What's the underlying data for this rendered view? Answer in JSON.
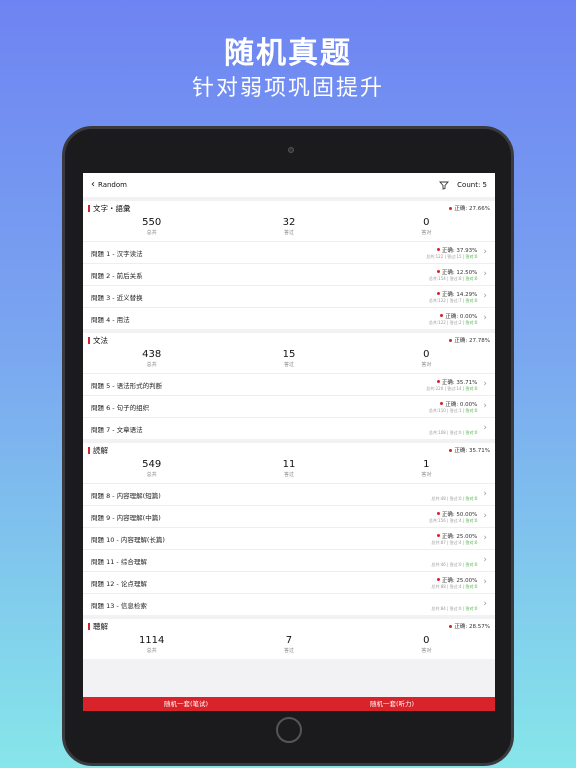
{
  "promo": {
    "title": "随机真题",
    "subtitle": "针对弱项巩固提升"
  },
  "nav": {
    "back_label": "Random",
    "count_label": "Count: 5"
  },
  "labels": {
    "total": "总共",
    "answered": "答过",
    "correct": "答对"
  },
  "sections": [
    {
      "title": "文字・語彙",
      "rate": "正确: 27.66%",
      "stats": {
        "total": "550",
        "answered": "32",
        "correct": "0"
      },
      "rows": [
        {
          "title": "問題 1 -   汉字读法",
          "rate": "正确: 37.93%",
          "meta": "总共:122 | 答过:15 | ",
          "meta_green": "答对:0"
        },
        {
          "title": "問題 2 -   前后关系",
          "rate": "正确: 12.50%",
          "meta": "总共:154 | 答过:8 | ",
          "meta_green": "答对:0"
        },
        {
          "title": "問題 3 -   近义替换",
          "rate": "正确: 14.29%",
          "meta": "总共:122 | 答过:7 | ",
          "meta_green": "答对:0"
        },
        {
          "title": "問題 4 -   用法",
          "rate": "正确: 0.00%",
          "meta": "总共:122 | 答过:2 | ",
          "meta_green": "答对:0"
        }
      ]
    },
    {
      "title": "文法",
      "rate": "正确: 27.78%",
      "stats": {
        "total": "438",
        "answered": "15",
        "correct": "0"
      },
      "rows": [
        {
          "title": "問題 5 -   语法形式的判断",
          "rate": "正确: 35.71%",
          "meta": "总共:220 | 答过:14 | ",
          "meta_green": "答对:0"
        },
        {
          "title": "問題 6 -   句子的组织",
          "rate": "正确: 0.00%",
          "meta": "总共:110 | 答过:1 | ",
          "meta_green": "答对:0"
        },
        {
          "title": "問題 7 -   文章语法",
          "rate": "",
          "meta": "总共:108 | 答过:0 | ",
          "meta_green": "答对:0"
        }
      ]
    },
    {
      "title": "読解",
      "rate": "正确: 35.71%",
      "stats": {
        "total": "549",
        "answered": "11",
        "correct": "1"
      },
      "rows": [
        {
          "title": "問題 8 -   内容理解(短篇)",
          "rate": "",
          "meta": "总共:48 | 答过:0 | ",
          "meta_green": "答对:0"
        },
        {
          "title": "問題 9 -   内容理解(中篇)",
          "rate": "正确: 50.00%",
          "meta": "总共:156 | 答过:4 | ",
          "meta_green": "答对:0"
        },
        {
          "title": "問題 10 -   内容理解(长篇)",
          "rate": "正确: 25.00%",
          "meta": "总共:87 | 答过:4 | ",
          "meta_green": "答对:0"
        },
        {
          "title": "問題 11 -   综合理解",
          "rate": "",
          "meta": "总共:46 | 答过:0 | ",
          "meta_green": "答对:0"
        },
        {
          "title": "問題 12 -   论点理解",
          "rate": "正确: 25.00%",
          "meta": "总共:88 | 答过:4 | ",
          "meta_green": "答对:0"
        },
        {
          "title": "問題 13 -   信息检索",
          "rate": "",
          "meta": "总共:84 | 答过:0 | ",
          "meta_green": "答对:0"
        }
      ]
    },
    {
      "title": "聴解",
      "rate": "正确: 28.57%",
      "stats": {
        "total": "1114",
        "answered": "7",
        "correct": "0"
      },
      "rows": []
    }
  ],
  "bottom": {
    "left_label": "随机一套(笔试)",
    "right_label": "随机一套(听力)"
  }
}
